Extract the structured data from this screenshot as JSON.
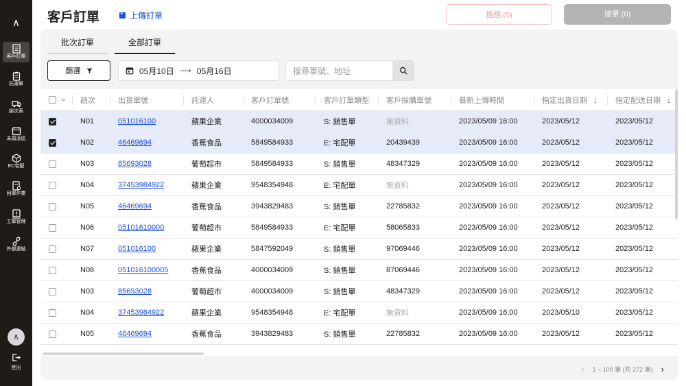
{
  "sidebar": {
    "logo": "∧",
    "items": [
      {
        "label": "客戶訂單"
      },
      {
        "label": "託運單"
      },
      {
        "label": "趟次表"
      },
      {
        "label": "未調派區"
      },
      {
        "label": "EC宅配"
      },
      {
        "label": "回單作業"
      },
      {
        "label": "工單管理"
      },
      {
        "label": "外部連結"
      }
    ],
    "avatar": "∧",
    "logout": "登出"
  },
  "header": {
    "title": "客戶訂單",
    "upload": "上傳訂單",
    "reject": "拒絕 (0)",
    "accept": "接單 (0)"
  },
  "tabs": [
    "批次訂單",
    "全部訂單"
  ],
  "toolbar": {
    "filter": "篩選",
    "date_from": "05月10日",
    "date_arrow": "⟶",
    "date_to": "05月16日",
    "search_placeholder": "搜尋單號、地址"
  },
  "table": {
    "headers": [
      "趟次",
      "出貨單號",
      "託運人",
      "客戶訂單號",
      "客戶訂單類型",
      "客戶採購單號",
      "最新上傳時間",
      "指定出貨日期",
      "指定配送日期"
    ],
    "sort_arrow": "↓",
    "rows": [
      {
        "selected": true,
        "trip": "N01",
        "ship": "051016100",
        "shipper": "蘋果企業",
        "order": "4000034009",
        "type": "S: 銷售單",
        "po": "無資料",
        "uploaded": "2023/05/09 16:00",
        "ship_date": "2023/05/12",
        "deliver_date": "2023/05/12"
      },
      {
        "selected": true,
        "trip": "N02",
        "ship": "46469694",
        "shipper": "香蕉食品",
        "order": "5849584933",
        "type": "E: 宅配單",
        "po": "20439439",
        "uploaded": "2023/05/09 16:00",
        "ship_date": "2023/05/12",
        "deliver_date": "2023/05/12"
      },
      {
        "selected": false,
        "trip": "N03",
        "ship": "85693028",
        "shipper": "葡萄超市",
        "order": "5849584933",
        "type": "S: 銷售單",
        "po": "48347329",
        "uploaded": "2023/05/09 16:00",
        "ship_date": "2023/05/12",
        "deliver_date": "2023/05/12"
      },
      {
        "selected": false,
        "trip": "N04",
        "ship": "37453984922",
        "shipper": "蘋果企業",
        "order": "9548354948",
        "type": "E: 宅配單",
        "po": "無資料",
        "uploaded": "2023/05/09 16:00",
        "ship_date": "2023/05/12",
        "deliver_date": "2023/05/12"
      },
      {
        "selected": false,
        "trip": "N05",
        "ship": "46469694",
        "shipper": "香蕉食品",
        "order": "3943829483",
        "type": "S: 銷售單",
        "po": "22785832",
        "uploaded": "2023/05/09 16:00",
        "ship_date": "2023/05/12",
        "deliver_date": "2023/05/12"
      },
      {
        "selected": false,
        "trip": "N06",
        "ship": "05101610000",
        "shipper": "葡萄超市",
        "order": "5849584933",
        "type": "E: 宅配單",
        "po": "58065833",
        "uploaded": "2023/05/09 16:00",
        "ship_date": "2023/05/12",
        "deliver_date": "2023/05/12"
      },
      {
        "selected": false,
        "trip": "N07",
        "ship": "051016100",
        "shipper": "蘋果企業",
        "order": "5847592049",
        "type": "S: 銷售單",
        "po": "97069446",
        "uploaded": "2023/05/09 16:00",
        "ship_date": "2023/05/12",
        "deliver_date": "2023/05/12"
      },
      {
        "selected": false,
        "trip": "N08",
        "ship": "051016100005",
        "shipper": "香蕉食品",
        "order": "4000034009",
        "type": "S: 銷售單",
        "po": "87069446",
        "uploaded": "2023/05/09 16:00",
        "ship_date": "2023/05/12",
        "deliver_date": "2023/05/12"
      },
      {
        "selected": false,
        "trip": "N03",
        "ship": "85693028",
        "shipper": "葡萄超市",
        "order": "4000034009",
        "type": "S: 銷售單",
        "po": "48347329",
        "uploaded": "2023/05/09 16:00",
        "ship_date": "2023/05/12",
        "deliver_date": "2023/05/12"
      },
      {
        "selected": false,
        "trip": "N04",
        "ship": "37453984922",
        "shipper": "蘋果企業",
        "order": "9548354948",
        "type": "E: 宅配單",
        "po": "無資料",
        "uploaded": "2023/05/09 16:00",
        "ship_date": "2023/05/10",
        "deliver_date": "2023/05/12"
      },
      {
        "selected": false,
        "trip": "N05",
        "ship": "46469694",
        "shipper": "香蕉食品",
        "order": "3943829483",
        "type": "S: 銷售單",
        "po": "22785832",
        "uploaded": "2023/05/09 16:00",
        "ship_date": "2023/05/12",
        "deliver_date": "2023/05/12"
      }
    ]
  },
  "pagination": {
    "range": "1 – 100 筆 (共 272 筆)",
    "prev": "‹",
    "next": "›"
  },
  "colors": {
    "sidebar_bg": "#1f1b17",
    "link": "#1d4ed8",
    "selected_row": "#e6ebf9",
    "reject_text": "#f1a0a0",
    "accept_bg": "#b4b4b4"
  }
}
